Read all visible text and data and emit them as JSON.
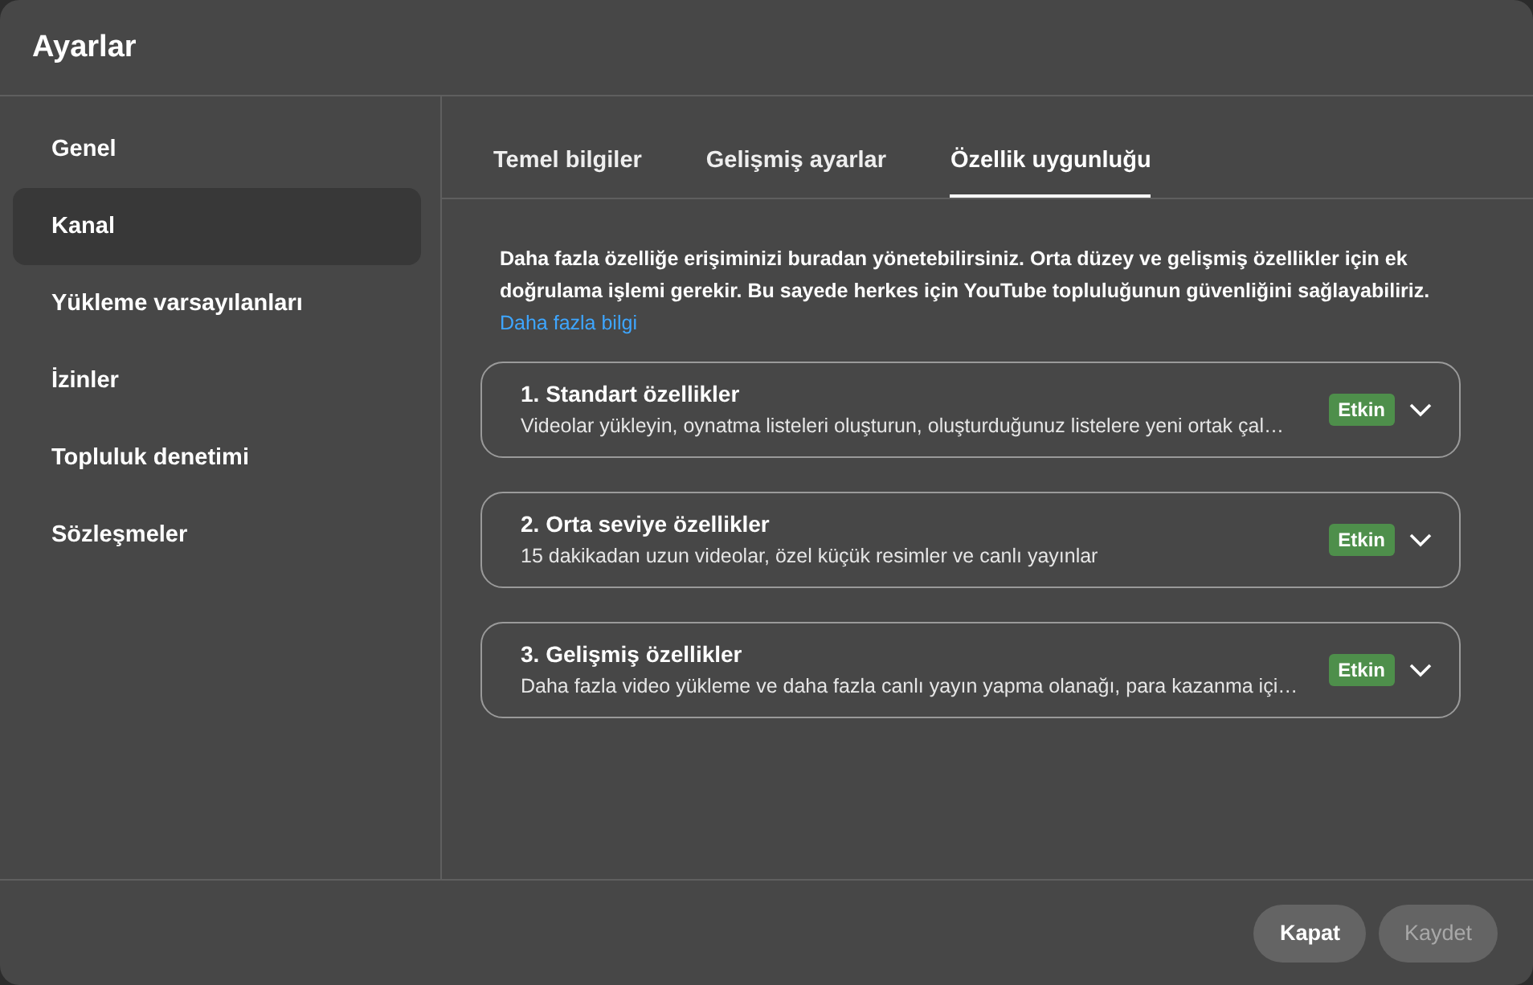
{
  "window": {
    "title": "Ayarlar"
  },
  "sidebar": {
    "items": [
      {
        "label": "Genel",
        "selected": false
      },
      {
        "label": "Kanal",
        "selected": true
      },
      {
        "label": "Yükleme varsayılanları",
        "selected": false
      },
      {
        "label": "İzinler",
        "selected": false
      },
      {
        "label": "Topluluk denetimi",
        "selected": false
      },
      {
        "label": "Sözleşmeler",
        "selected": false
      }
    ]
  },
  "tabs": [
    {
      "label": "Temel bilgiler",
      "selected": false
    },
    {
      "label": "Gelişmiş ayarlar",
      "selected": false
    },
    {
      "label": "Özellik uygunluğu",
      "selected": true
    }
  ],
  "intro": {
    "text": "Daha fazla özelliğe erişiminizi buradan yönetebilirsiniz. Orta düzey ve gelişmiş özellikler için ek doğrulama işlemi gerekir. Bu sayede herkes için YouTube topluluğunun güvenliğini sağlayabiliriz.",
    "link": "Daha fazla bilgi"
  },
  "features": [
    {
      "title": "1. Standart özellikler",
      "description": "Videolar yükleyin, oynatma listeleri oluşturun, oluşturduğunuz listelere yeni ortak çal…",
      "status": "Etkin",
      "enabled": true,
      "expanded": false
    },
    {
      "title": "2. Orta seviye özellikler",
      "description": "15 dakikadan uzun videolar, özel küçük resimler ve canlı yayınlar",
      "status": "Etkin",
      "enabled": true,
      "expanded": false
    },
    {
      "title": "3. Gelişmiş özellikler",
      "description": "Daha fazla video yükleme ve daha fazla canlı yayın yapma olanağı, para kazanma içi…",
      "status": "Etkin",
      "enabled": true,
      "expanded": false
    }
  ],
  "buttons": [
    {
      "label": "Kapat",
      "disabled": false
    },
    {
      "label": "Kaydet",
      "disabled": true
    }
  ]
}
